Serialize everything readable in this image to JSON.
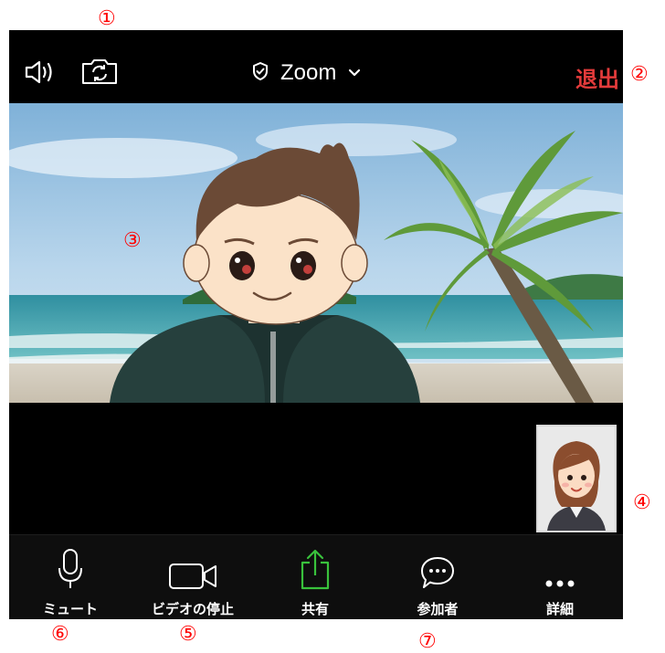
{
  "annotations": {
    "n1": "①",
    "n2": "②",
    "n3": "③",
    "n4": "④",
    "n5": "⑤",
    "n6": "⑥",
    "n7": "⑦"
  },
  "topbar": {
    "speaker_icon": "speaker-icon",
    "camera_switch_icon": "camera-switch-icon",
    "shield_icon": "shield-icon",
    "title": "Zoom",
    "dropdown_icon": "chevron-down-icon",
    "leave_label": "退出"
  },
  "toolbar": {
    "items": [
      {
        "label": "ミュート",
        "icon": "microphone-icon"
      },
      {
        "label": "ビデオの停止",
        "icon": "video-camera-icon"
      },
      {
        "label": "共有",
        "icon": "share-icon"
      },
      {
        "label": "参加者",
        "icon": "chat-bubble-icon"
      },
      {
        "label": "詳細",
        "icon": "more-icon"
      }
    ]
  },
  "colors": {
    "annotation": "#ff0000",
    "leave": "#e33b3b",
    "share": "#39c23c",
    "background": "#000000"
  }
}
